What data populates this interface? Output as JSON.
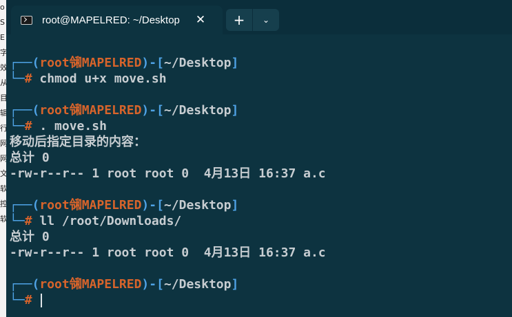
{
  "behind_window": {
    "chars": [
      "o",
      "S",
      "E",
      "字",
      "",
      "效",
      "从",
      "",
      "目",
      "",
      "辑",
      "行",
      "",
      "网",
      "网",
      "文",
      "软",
      "控",
      "软"
    ]
  },
  "tab": {
    "title": "root@MAPELRED: ~/Desktop",
    "close_glyph": "✕",
    "icon": "terminal-icon"
  },
  "tab_buttons": {
    "new_tab": "+",
    "dropdown": "⌄"
  },
  "colors": {
    "background": "#0d3340",
    "prompt_frame": "#4fa3e6",
    "prompt_host": "#d8642b",
    "text": "#c7cdd1"
  },
  "prompt": {
    "open": "┌──(",
    "user": "root",
    "at": "㋿",
    "host": "MAPELRED",
    "close": ")-[",
    "path": "~/Desktop",
    "end": "]",
    "second_prefix": "└─",
    "hash": "#"
  },
  "session": {
    "cmd1": " chmod u+x move.sh",
    "cmd2": " . move.sh",
    "out2_line1": "移动后指定目录的内容：",
    "out2_line2": "总计 0",
    "out2_line3": "-rw-r--r-- 1 root root 0  4月13日 16:37 a.c",
    "cmd3": " ll /root/Downloads/",
    "out3_line1": "总计 0",
    "out3_line2": "-rw-r--r-- 1 root root 0  4月13日 16:37 a.c",
    "cmd4": " "
  }
}
